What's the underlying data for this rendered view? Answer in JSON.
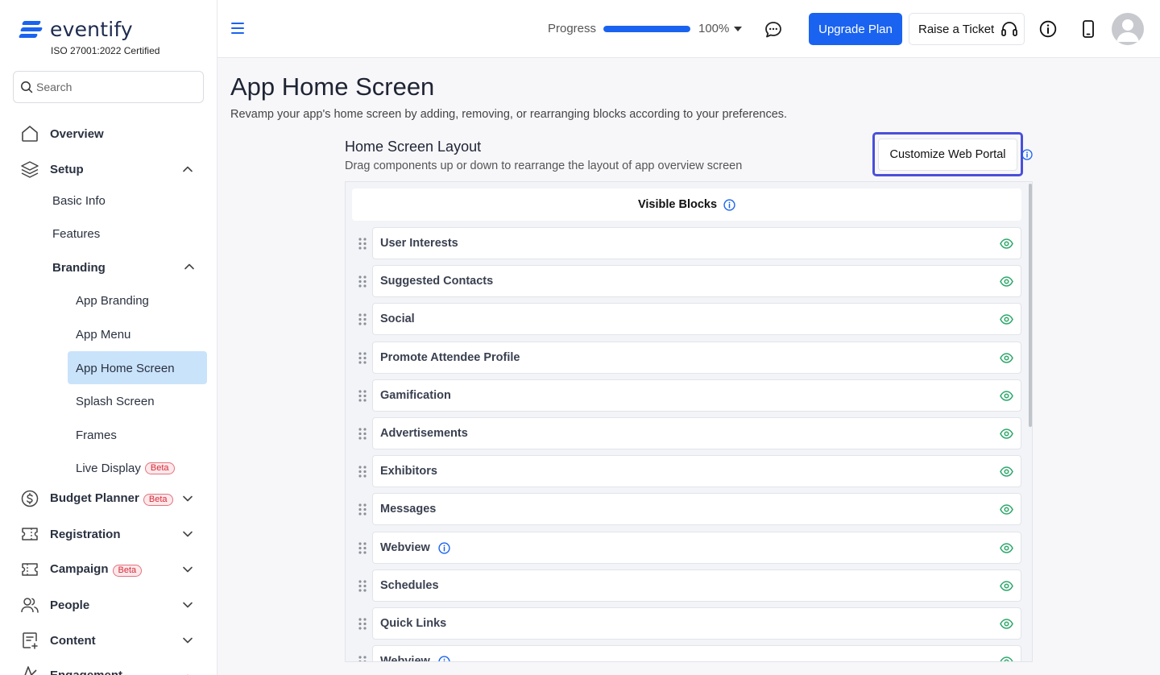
{
  "brand": {
    "name": "eventify",
    "cert": "ISO 27001:2022 Certified",
    "accent": "#1a63f0"
  },
  "search": {
    "placeholder": "Search"
  },
  "sidebar": {
    "overview": "Overview",
    "setup": "Setup",
    "basic_info": "Basic Info",
    "features": "Features",
    "branding": "Branding",
    "app_branding": "App Branding",
    "app_menu": "App Menu",
    "app_home_screen": "App Home Screen",
    "splash_screen": "Splash Screen",
    "frames": "Frames",
    "live_display": "Live Display",
    "budget_planner": "Budget Planner",
    "registration": "Registration",
    "campaign": "Campaign",
    "people": "People",
    "content": "Content",
    "engagement": "Engagement",
    "beta": "Beta"
  },
  "topbar": {
    "progress_label": "Progress",
    "progress_value": 100,
    "progress_text": "100%",
    "upgrade": "Upgrade Plan",
    "ticket": "Raise a Ticket"
  },
  "page": {
    "title": "App Home Screen",
    "subtitle": "Revamp your app's home screen by adding, removing, or rearranging blocks according to your preferences."
  },
  "layout": {
    "title": "Home Screen Layout",
    "subtitle": "Drag components up or down to rearrange the layout of app overview screen",
    "customize_btn": "Customize Web Portal",
    "visible_blocks": "Visible Blocks",
    "blocks": [
      {
        "name": "User Interests"
      },
      {
        "name": "Suggested Contacts"
      },
      {
        "name": "Social"
      },
      {
        "name": "Promote Attendee Profile"
      },
      {
        "name": "Gamification"
      },
      {
        "name": "Advertisements"
      },
      {
        "name": "Exhibitors"
      },
      {
        "name": "Messages"
      },
      {
        "name": "Webview"
      },
      {
        "name": "Schedules"
      },
      {
        "name": "Quick Links"
      },
      {
        "name": "Webview"
      }
    ]
  }
}
